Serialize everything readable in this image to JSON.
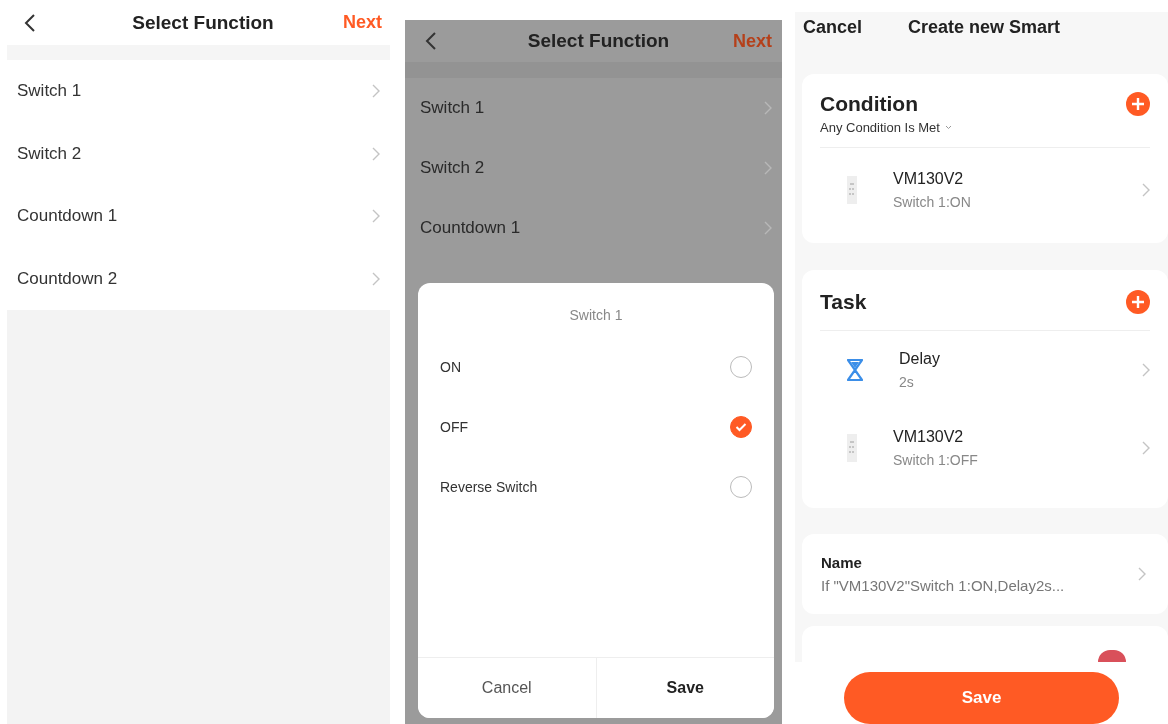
{
  "function_list": {
    "title": "Select Function",
    "next": "Next",
    "items": [
      "Switch 1",
      "Switch 2",
      "Countdown 1",
      "Countdown 2"
    ]
  },
  "function_dialog": {
    "title": "Select Function",
    "next": "Next",
    "items": [
      "Switch 1",
      "Switch 2",
      "Countdown 1"
    ],
    "dialog": {
      "title": "Switch 1",
      "options": [
        {
          "label": "ON",
          "selected": false
        },
        {
          "label": "OFF",
          "selected": true
        },
        {
          "label": "Reverse Switch",
          "selected": false
        }
      ],
      "cancel": "Cancel",
      "save": "Save"
    }
  },
  "create_smart": {
    "cancel": "Cancel",
    "title": "Create new Smart",
    "condition": {
      "title": "Condition",
      "mode": "Any Condition Is Met",
      "items": [
        {
          "kind": "device",
          "name": "VM130V2",
          "detail": "Switch 1:ON"
        }
      ]
    },
    "task": {
      "title": "Task",
      "items": [
        {
          "kind": "delay",
          "name": "Delay",
          "detail": "2s"
        },
        {
          "kind": "device",
          "name": "VM130V2",
          "detail": "Switch 1:OFF"
        }
      ]
    },
    "name": {
      "label": "Name",
      "value": "If \"VM130V2\"Switch 1:ON,Delay2s..."
    },
    "style": {
      "color": "#d9505a"
    },
    "save": "Save"
  }
}
